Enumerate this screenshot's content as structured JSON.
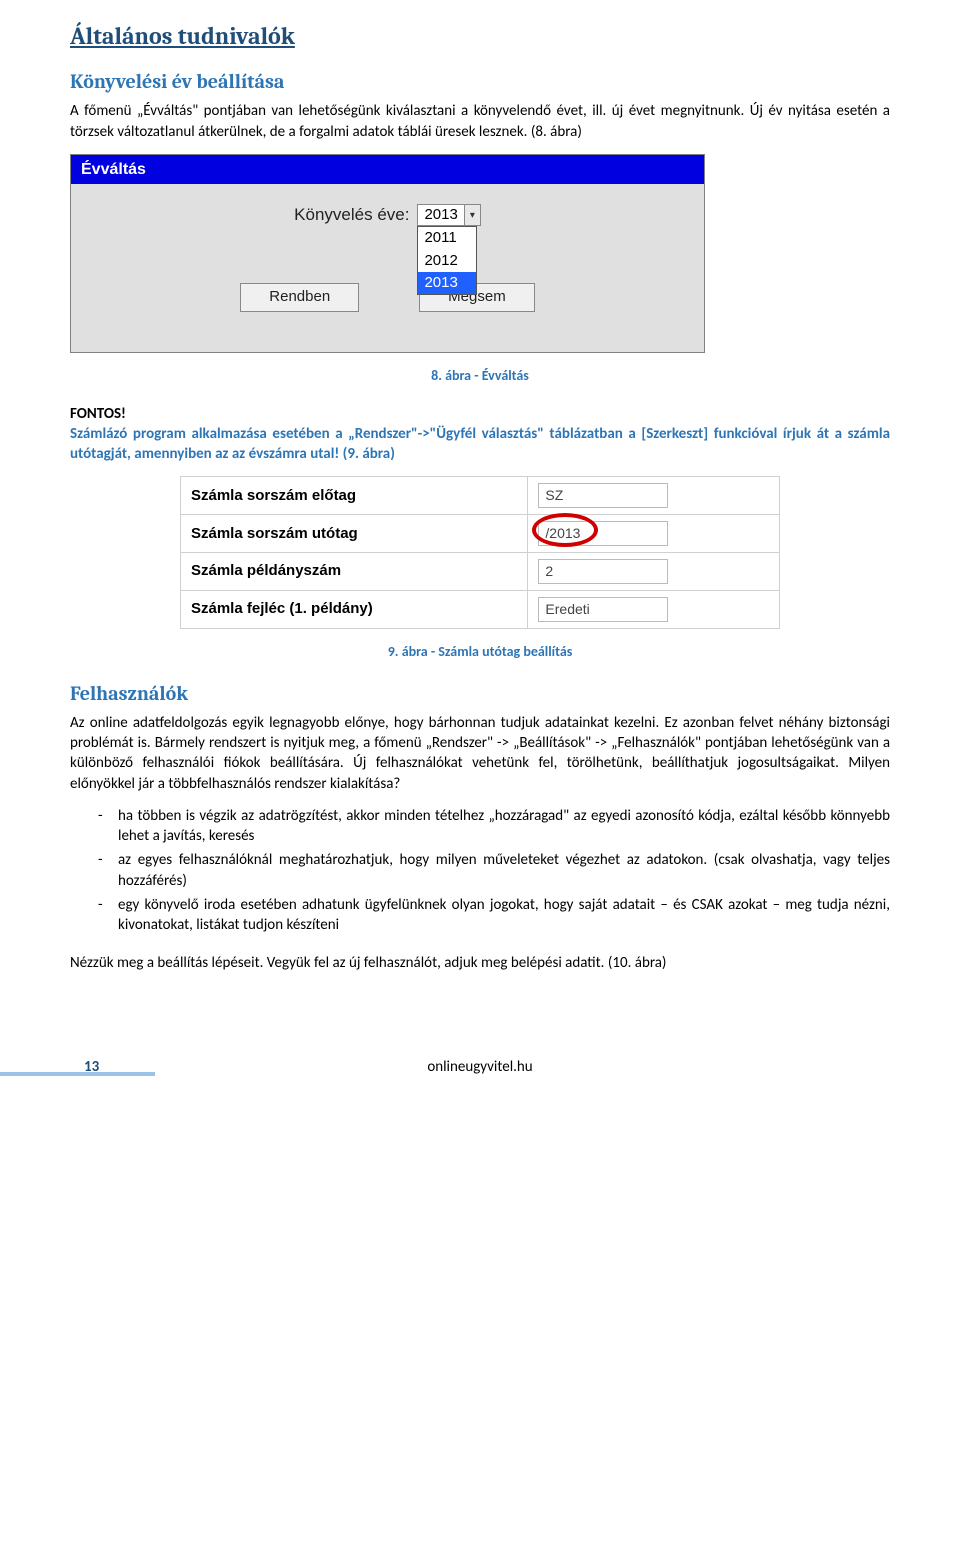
{
  "headings": {
    "main": "Általános tudnivalók",
    "sub1": "Könyvelési év beállítása",
    "sub2": "Felhasználók"
  },
  "paragraphs": {
    "p1": "A főmenü „Évváltás\" pontjában van lehetőségünk kiválasztani a könyvelendő évet, ill. új évet megnyitnunk. Új év nyitása esetén a törzsek változatlanul átkerülnek, de a forgalmi adatok táblái üresek lesznek. (8. ábra)",
    "fontos": "FONTOS!",
    "blue_note": "Számlázó program alkalmazása esetében a „Rendszer\"->\"Ügyfél választás\" táblázatban a [Szerkeszt] funkcióval írjuk át a számla utótagját, amennyiben az az évszámra utal! (9. ábra)",
    "p_users": "Az online adatfeldolgozás egyik legnagyobb előnye, hogy bárhonnan tudjuk adatainkat kezelni. Ez azonban felvet néhány biztonsági problémát is. Bármely rendszert is nyitjuk meg, a főmenü „Rendszer\" -> „Beállítások\" -> „Felhasználók\" pontjában lehetőségünk van a különböző felhasználói fiókok beállítására. Új felhasználókat vehetünk fel, törölhetünk, beállíthatjuk jogosultságaikat. Milyen előnyökkel jár a többfelhasználós rendszer kialakítása?",
    "closing": "Nézzük meg a beállítás lépéseit. Vegyük fel az új felhasználót, adjuk meg belépési adatit. (10. ábra)"
  },
  "captions": {
    "fig8": "8. ábra - Évváltás",
    "fig9": "9. ábra - Számla utótag beállítás"
  },
  "fig8": {
    "title": "Évváltás",
    "label": "Könyvelés éve:",
    "selected": "2013",
    "options": [
      "2011",
      "2012",
      "2013"
    ],
    "ok": "Rendben",
    "cancel": "Mégsem"
  },
  "fig9": {
    "rows": [
      {
        "label": "Számla sorszám előtag",
        "value": "SZ"
      },
      {
        "label": "Számla sorszám utótag",
        "value": "/2013",
        "circle": true
      },
      {
        "label": "Számla példányszám",
        "value": "2"
      },
      {
        "label": "Számla fejléc (1. példány)",
        "value": "Eredeti"
      }
    ]
  },
  "bullets": [
    "ha többen is végzik az adatrögzítést, akkor minden tételhez „hozzáragad\" az egyedi azonosító kódja, ezáltal később könnyebb lehet a javítás, keresés",
    "az egyes felhasználóknál meghatározhatjuk, hogy milyen műveleteket végezhet az adatokon. (csak olvashatja, vagy teljes hozzáférés)",
    "egy könyvelő iroda esetében adhatunk ügyfelünknek olyan jogokat, hogy saját adatait – és CSAK azokat – meg tudja nézni, kivonatokat, listákat tudjon készíteni"
  ],
  "footer": {
    "page": "13",
    "url": "onlineugyvitel.hu"
  }
}
